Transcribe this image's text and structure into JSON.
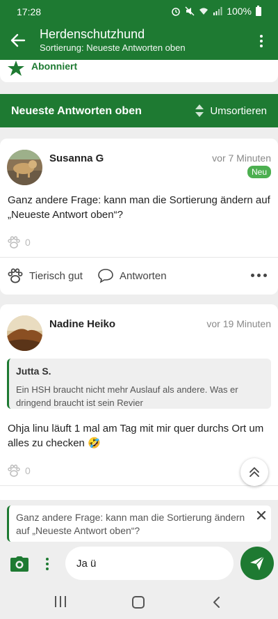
{
  "status_bar": {
    "time": "17:28",
    "battery": "100%"
  },
  "app_bar": {
    "title": "Herdenschutzhund",
    "subtitle": "Sortierung: Neueste Antworten oben"
  },
  "subscription": {
    "label": "Abonniert"
  },
  "sort_bar": {
    "title": "Neueste Antworten oben",
    "resort_label": "Umsortieren"
  },
  "posts": [
    {
      "author": "Susanna G",
      "time": "vor 7 Minuten",
      "badge": "Neu",
      "text": "Ganz andere Frage: kann man die Sortierung ändern auf „Neueste Antwort oben“?",
      "likes": "0",
      "like_label": "Tierisch gut",
      "reply_label": "Antworten"
    },
    {
      "author": "Nadine Heiko",
      "time": "vor 19 Minuten",
      "quote_author": "Jutta S.",
      "quote_text": "Ein HSH braucht nicht mehr Auslauf als andere. Was er dringend  braucht ist sein Revier",
      "text": "Ohja linu läuft 1 mal am Tag mit mir quer durchs Ort um alles zu checken 🤣",
      "likes": "0"
    }
  ],
  "reply": {
    "quoted_text": "Ganz andere Frage: kann man die Sortierung ändern auf „Neueste Antwort oben“?",
    "input_value": "Ja ü"
  },
  "colors": {
    "primary": "#1e7a32",
    "badge": "#4caf50",
    "background": "#eeeeee"
  }
}
